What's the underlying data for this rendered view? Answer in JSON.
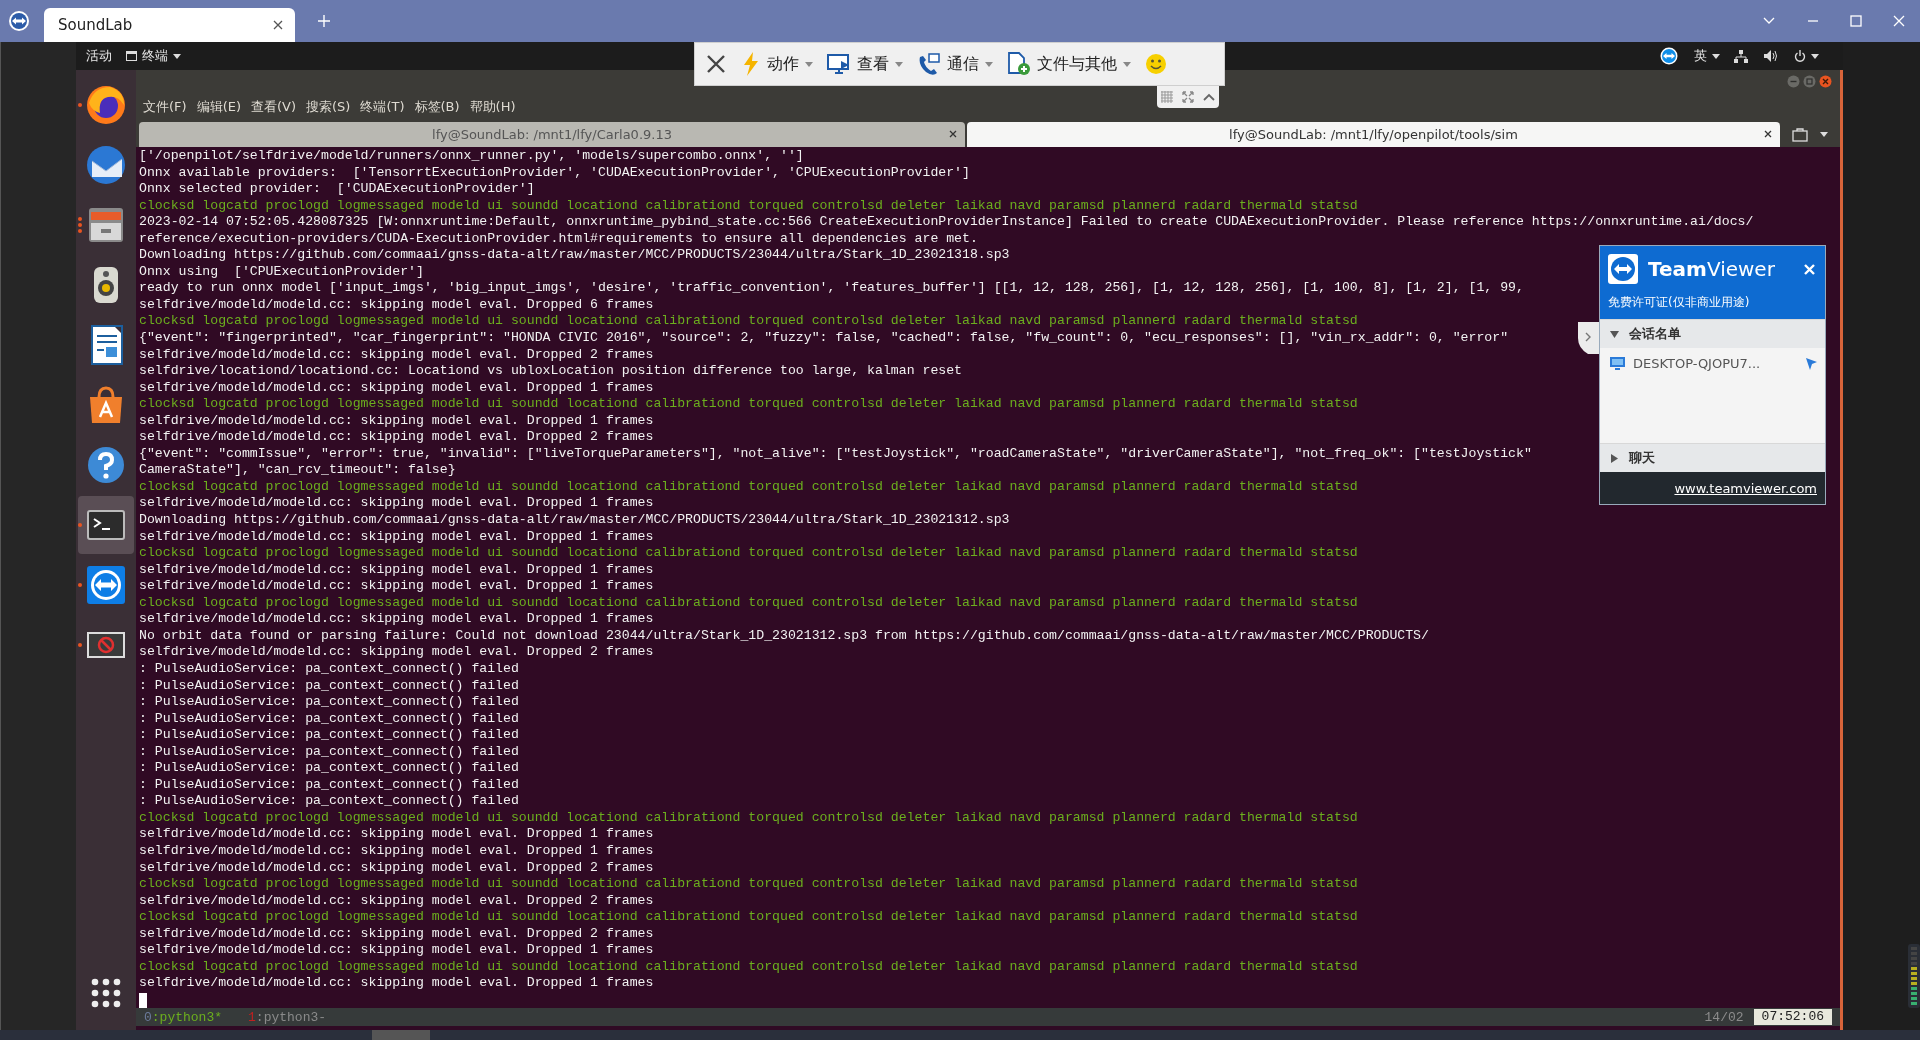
{
  "window": {
    "tab_title": "SoundLab"
  },
  "top_bar": {
    "activities": "活动",
    "app_menu": "终端",
    "input_method": "英"
  },
  "tv_toolbar": {
    "items": [
      {
        "kind": "close"
      },
      {
        "kind": "action",
        "label": "动作"
      },
      {
        "kind": "view",
        "label": "查看"
      },
      {
        "kind": "communicate",
        "label": "通信"
      },
      {
        "kind": "files",
        "label": "文件与其他"
      },
      {
        "kind": "smiley"
      }
    ]
  },
  "dock": {
    "items": [
      {
        "kind": "firefox",
        "running": true,
        "selected": false
      },
      {
        "kind": "mail",
        "running": false,
        "selected": false
      },
      {
        "kind": "files",
        "running": true,
        "multiple_windows": true,
        "selected": false
      },
      {
        "kind": "speaker",
        "running": false,
        "selected": false
      },
      {
        "kind": "document",
        "running": false,
        "selected": false
      },
      {
        "kind": "store",
        "running": false,
        "selected": false
      },
      {
        "kind": "help",
        "running": false,
        "selected": false
      },
      {
        "kind": "terminal",
        "running": true,
        "selected": true
      },
      {
        "kind": "teamviewer",
        "running": true,
        "selected": false
      },
      {
        "kind": "blocked",
        "running": true,
        "selected": false
      }
    ]
  },
  "terminal": {
    "menu": [
      "文件(F)",
      "编辑(E)",
      "查看(V)",
      "搜索(S)",
      "终端(T)",
      "标签(B)",
      "帮助(H)"
    ],
    "tabs": [
      {
        "title": "lfy@SoundLab: /mnt1/lfy/Carla0.9.13",
        "selected": false
      },
      {
        "title": "lfy@SoundLab: /mnt1/lfy/openpilot/tools/sim",
        "selected": true
      }
    ],
    "lines": [
      {
        "kind": "plain",
        "text": "['/openpilot/selfdrive/modeld/runners/onnx_runner.py', 'models/supercombo.onnx', '']"
      },
      {
        "kind": "plain",
        "text": "Onnx available providers:  ['TensorrtExecutionProvider', 'CUDAExecutionProvider', 'CPUExecutionProvider']"
      },
      {
        "kind": "plain",
        "text": "Onnx selected provider:  ['CUDAExecutionProvider']"
      },
      {
        "kind": "daemons",
        "text": "clocksd logcatd proclogd logmessaged modeld ui soundd locationd calibrationd torqued controlsd deleter laikad navd paramsd plannerd radard thermald statsd"
      },
      {
        "kind": "plain",
        "text": "2023-02-14 07:52:05.428087325 [W:onnxruntime:Default, onnxruntime_pybind_state.cc:566 CreateExecutionProviderInstance] Failed to create CUDAExecutionProvider. Please reference https://onnxruntime.ai/docs/"
      },
      {
        "kind": "plain",
        "text": "reference/execution-providers/CUDA-ExecutionProvider.html#requirements to ensure all dependencies are met."
      },
      {
        "kind": "plain",
        "text": "Downloading https://github.com/commaai/gnss-data-alt/raw/master/MCC/PRODUCTS/23044/ultra/Stark_1D_23021318.sp3"
      },
      {
        "kind": "plain",
        "text": "Onnx using  ['CPUExecutionProvider']"
      },
      {
        "kind": "plain",
        "text": "ready to run onnx model ['input_imgs', 'big_input_imgs', 'desire', 'traffic_convention', 'features_buffer'] [[1, 12, 128, 256], [1, 12, 128, 256], [1, 100, 8], [1, 2], [1, 99,"
      },
      {
        "kind": "plain",
        "text": "selfdrive/modeld/modeld.cc: skipping model eval. Dropped 6 frames"
      },
      {
        "kind": "daemons",
        "text": "clocksd logcatd proclogd logmessaged modeld ui soundd locationd calibrationd torqued controlsd deleter laikad navd paramsd plannerd radard thermald statsd"
      },
      {
        "kind": "plain",
        "text": "{\"event\": \"fingerprinted\", \"car_fingerprint\": \"HONDA CIVIC 2016\", \"source\": 2, \"fuzzy\": false, \"cached\": false, \"fw_count\": 0, \"ecu_responses\": [], \"vin_rx_addr\": 0, \"error\""
      },
      {
        "kind": "plain",
        "text": "selfdrive/modeld/modeld.cc: skipping model eval. Dropped 2 frames"
      },
      {
        "kind": "plain",
        "text": "selfdrive/locationd/locationd.cc: Locationd vs ubloxLocation position difference too large, kalman reset"
      },
      {
        "kind": "plain",
        "text": "selfdrive/modeld/modeld.cc: skipping model eval. Dropped 1 frames"
      },
      {
        "kind": "daemons",
        "text": "clocksd logcatd proclogd logmessaged modeld ui soundd locationd calibrationd torqued controlsd deleter laikad navd paramsd plannerd radard thermald statsd"
      },
      {
        "kind": "plain",
        "text": "selfdrive/modeld/modeld.cc: skipping model eval. Dropped 1 frames"
      },
      {
        "kind": "plain",
        "text": "selfdrive/modeld/modeld.cc: skipping model eval. Dropped 2 frames"
      },
      {
        "kind": "plain",
        "text": "{\"event\": \"commIssue\", \"error\": true, \"invalid\": [\"liveTorqueParameters\"], \"not_alive\": [\"testJoystick\", \"roadCameraState\", \"driverCameraState\"], \"not_freq_ok\": [\"testJoystick\""
      },
      {
        "kind": "plain",
        "text": "CameraState\"], \"can_rcv_timeout\": false}"
      },
      {
        "kind": "daemons",
        "text": "clocksd logcatd proclogd logmessaged modeld ui soundd locationd calibrationd torqued controlsd deleter laikad navd paramsd plannerd radard thermald statsd"
      },
      {
        "kind": "plain",
        "text": "selfdrive/modeld/modeld.cc: skipping model eval. Dropped 1 frames"
      },
      {
        "kind": "plain",
        "text": "Downloading https://github.com/commaai/gnss-data-alt/raw/master/MCC/PRODUCTS/23044/ultra/Stark_1D_23021312.sp3"
      },
      {
        "kind": "plain",
        "text": "selfdrive/modeld/modeld.cc: skipping model eval. Dropped 1 frames"
      },
      {
        "kind": "daemons",
        "text": "clocksd logcatd proclogd logmessaged modeld ui soundd locationd calibrationd torqued controlsd deleter laikad navd paramsd plannerd radard thermald statsd"
      },
      {
        "kind": "plain",
        "text": "selfdrive/modeld/modeld.cc: skipping model eval. Dropped 1 frames"
      },
      {
        "kind": "plain",
        "text": "selfdrive/modeld/modeld.cc: skipping model eval. Dropped 1 frames"
      },
      {
        "kind": "daemons",
        "text": "clocksd logcatd proclogd logmessaged modeld ui soundd locationd calibrationd torqued controlsd deleter laikad navd paramsd plannerd radard thermald statsd"
      },
      {
        "kind": "plain",
        "text": "selfdrive/modeld/modeld.cc: skipping model eval. Dropped 1 frames"
      },
      {
        "kind": "plain",
        "text": "No orbit data found or parsing failure: Could not download 23044/ultra/Stark_1D_23021312.sp3 from https://github.com/commaai/gnss-data-alt/raw/master/MCC/PRODUCTS/"
      },
      {
        "kind": "plain",
        "text": "selfdrive/modeld/modeld.cc: skipping model eval. Dropped 2 frames"
      },
      {
        "kind": "plain",
        "text": ": PulseAudioService: pa_context_connect() failed"
      },
      {
        "kind": "plain",
        "text": ": PulseAudioService: pa_context_connect() failed"
      },
      {
        "kind": "plain",
        "text": ": PulseAudioService: pa_context_connect() failed"
      },
      {
        "kind": "plain",
        "text": ": PulseAudioService: pa_context_connect() failed"
      },
      {
        "kind": "plain",
        "text": ": PulseAudioService: pa_context_connect() failed"
      },
      {
        "kind": "plain",
        "text": ": PulseAudioService: pa_context_connect() failed"
      },
      {
        "kind": "plain",
        "text": ": PulseAudioService: pa_context_connect() failed"
      },
      {
        "kind": "plain",
        "text": ": PulseAudioService: pa_context_connect() failed"
      },
      {
        "kind": "plain",
        "text": ": PulseAudioService: pa_context_connect() failed"
      },
      {
        "kind": "daemons",
        "text": "clocksd logcatd proclogd logmessaged modeld ui soundd locationd calibrationd torqued controlsd deleter laikad navd paramsd plannerd radard thermald statsd"
      },
      {
        "kind": "plain",
        "text": "selfdrive/modeld/modeld.cc: skipping model eval. Dropped 1 frames"
      },
      {
        "kind": "plain",
        "text": "selfdrive/modeld/modeld.cc: skipping model eval. Dropped 1 frames"
      },
      {
        "kind": "plain",
        "text": "selfdrive/modeld/modeld.cc: skipping model eval. Dropped 2 frames"
      },
      {
        "kind": "daemons",
        "text": "clocksd logcatd proclogd logmessaged modeld ui soundd locationd calibrationd torqued controlsd deleter laikad navd paramsd plannerd radard thermald statsd"
      },
      {
        "kind": "plain",
        "text": "selfdrive/modeld/modeld.cc: skipping model eval. Dropped 2 frames"
      },
      {
        "kind": "daemons",
        "text": "clocksd logcatd proclogd logmessaged modeld ui soundd locationd calibrationd torqued controlsd deleter laikad navd paramsd plannerd radard thermald statsd"
      },
      {
        "kind": "plain",
        "text": "selfdrive/modeld/modeld.cc: skipping model eval. Dropped 2 frames"
      },
      {
        "kind": "plain",
        "text": "selfdrive/modeld/modeld.cc: skipping model eval. Dropped 1 frames"
      },
      {
        "kind": "daemons",
        "text": "clocksd logcatd proclogd logmessaged modeld ui soundd locationd calibrationd torqued controlsd deleter laikad navd paramsd plannerd radard thermald statsd"
      },
      {
        "kind": "plain",
        "text": "selfdrive/modeld/modeld.cc: skipping model eval. Dropped 1 frames"
      }
    ],
    "status": {
      "windows": [
        {
          "index": "0",
          "name": ":python3*",
          "selected": true
        },
        {
          "index": "1",
          "name": ":python3-",
          "selected": false
        }
      ],
      "date": "14/02",
      "time": "07:52:06"
    }
  },
  "teamviewer_panel": {
    "title": "**Team**Viewer",
    "license": "免费许可证(仅非商业用途)",
    "sections": [
      {
        "label": "会话名单",
        "expanded": true,
        "items": [
          "DESKTOP-QJOPU7..."
        ]
      },
      {
        "label": "聊天",
        "expanded": false
      }
    ],
    "link": "www.teamviewer.com"
  }
}
